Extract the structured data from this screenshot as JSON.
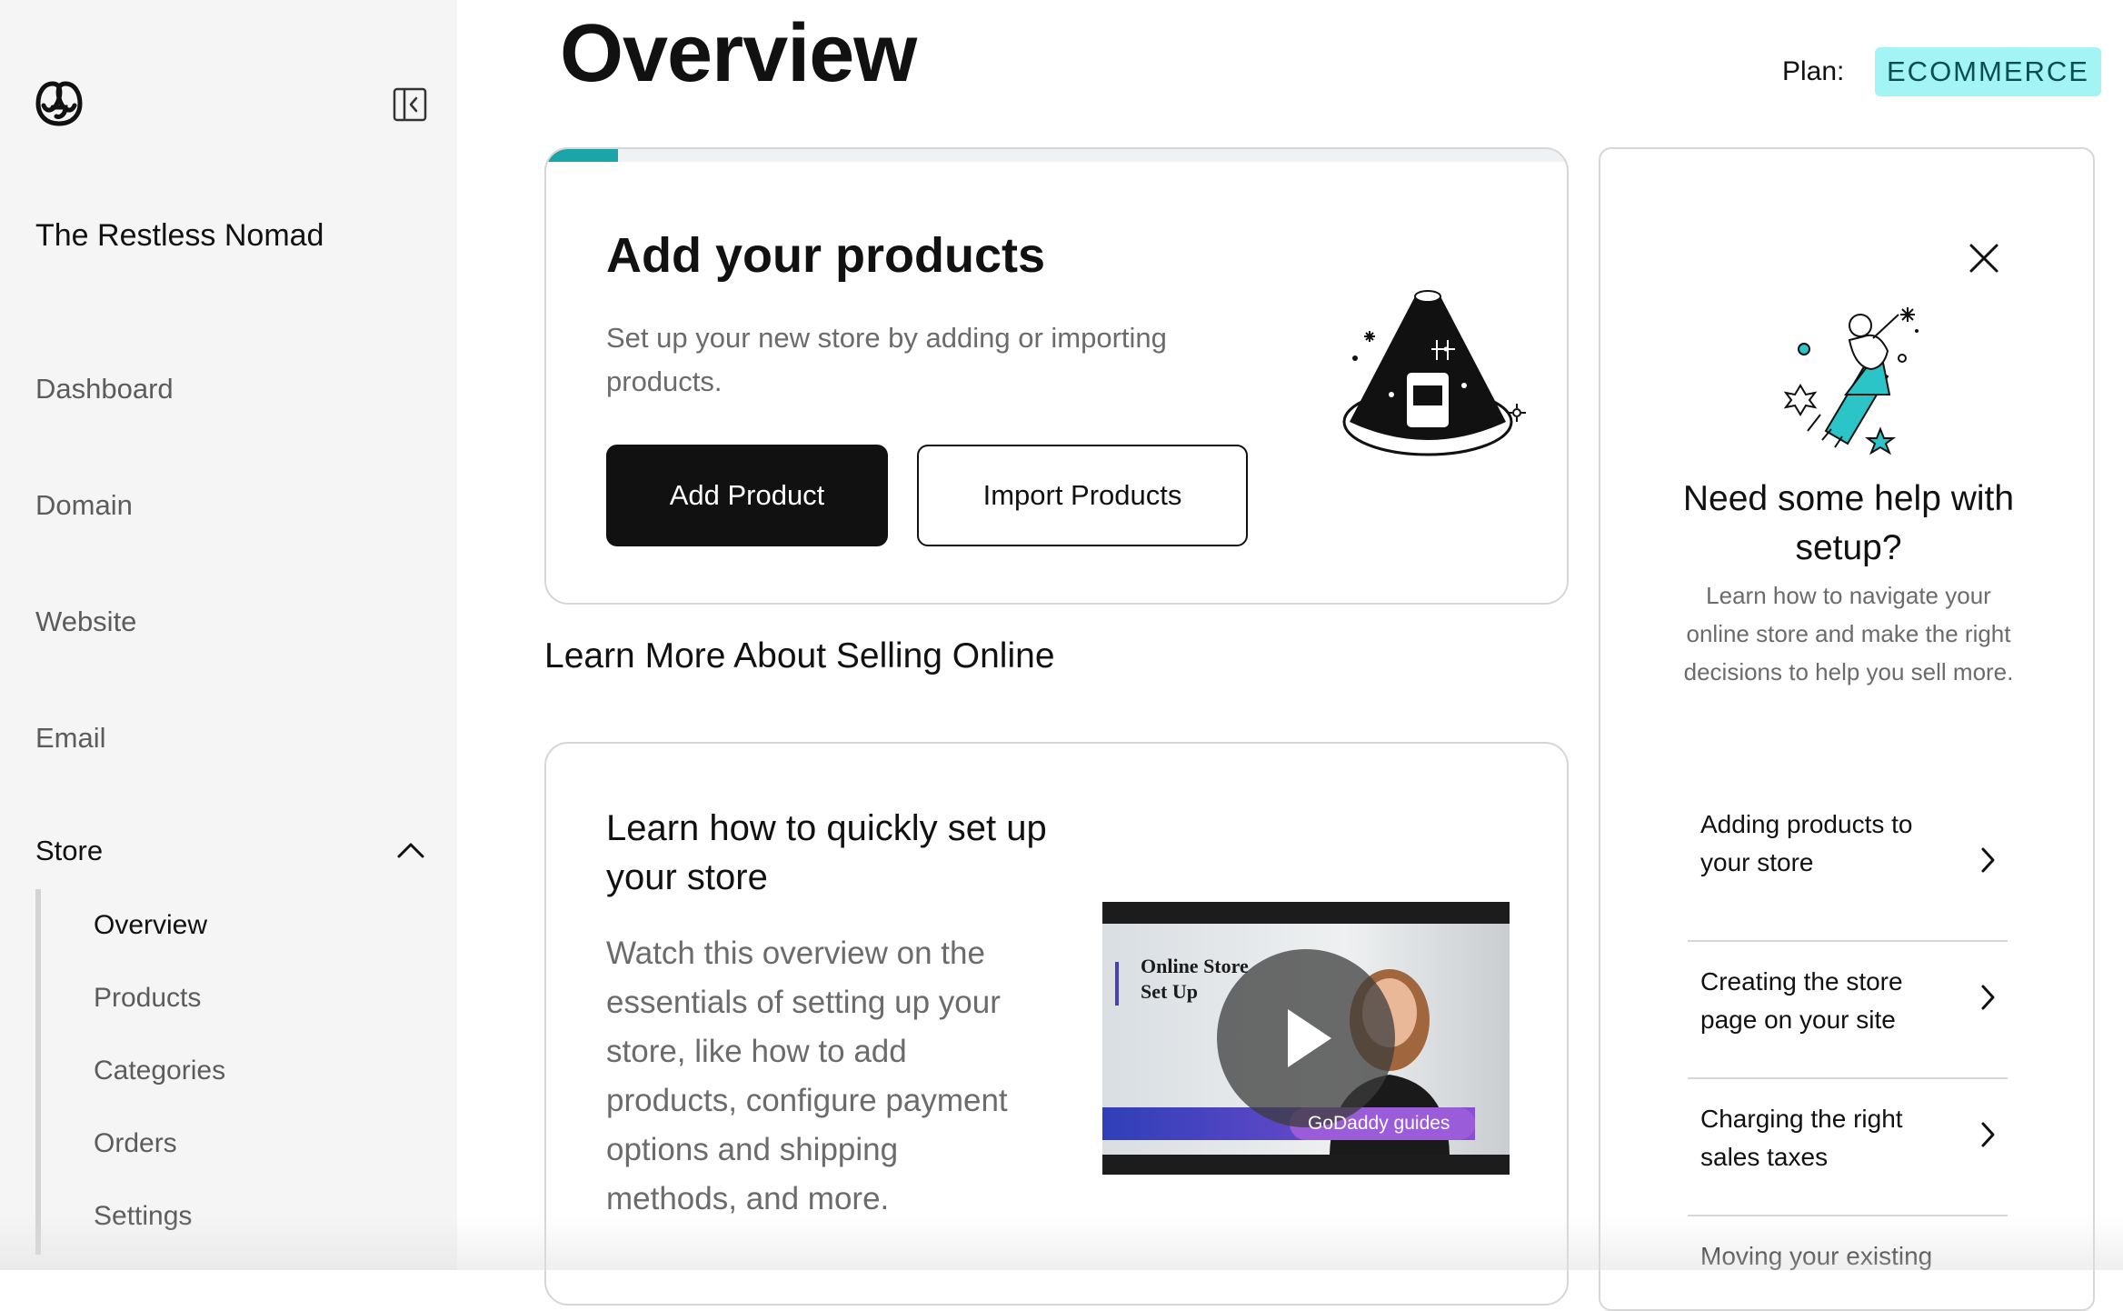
{
  "sidebar": {
    "store_name": "The Restless Nomad",
    "nav": [
      {
        "label": "Dashboard"
      },
      {
        "label": "Domain"
      },
      {
        "label": "Website"
      },
      {
        "label": "Email"
      }
    ],
    "store_section": {
      "label": "Store",
      "expanded": true,
      "items": [
        {
          "label": "Overview",
          "active": true
        },
        {
          "label": "Products"
        },
        {
          "label": "Categories"
        },
        {
          "label": "Orders"
        },
        {
          "label": "Settings"
        }
      ]
    },
    "icons": {
      "logo": "godaddy-logo",
      "collapse": "sidebar-collapse-icon",
      "chevron": "chevron-up-icon"
    }
  },
  "header": {
    "title": "Overview",
    "plan_label": "Plan:",
    "plan_value": "ECOMMERCE"
  },
  "products_card": {
    "progress": 0.07,
    "title": "Add your products",
    "description": "Set up your new store by adding or importing products.",
    "primary_button": "Add Product",
    "secondary_button": "Import Products"
  },
  "learn_more": {
    "heading": "Learn More About Selling Online",
    "card_title": "Learn how to quickly set up your store",
    "card_description": "Watch this overview on the essentials of setting up your store, like how to add products, configure payment options and shipping methods, and more.",
    "video": {
      "caption_line1": "Online Store",
      "caption_line2": "Set Up",
      "brand": "GoDaddy guides"
    }
  },
  "help_panel": {
    "title": "Need some help with setup?",
    "description": "Learn how to navigate your online store and make the right decisions to help you sell more.",
    "links": [
      {
        "label": "Adding products to your store"
      },
      {
        "label": "Creating the store page on your site"
      },
      {
        "label": "Charging the right sales taxes"
      },
      {
        "label": "Moving your existing"
      }
    ]
  },
  "colors": {
    "accent": "#1aa6a8",
    "plan_badge_bg": "#a3f5f5",
    "plan_badge_text": "#0a4d54",
    "primary_button": "#111111",
    "sidebar_bg": "#f5f5f5"
  }
}
